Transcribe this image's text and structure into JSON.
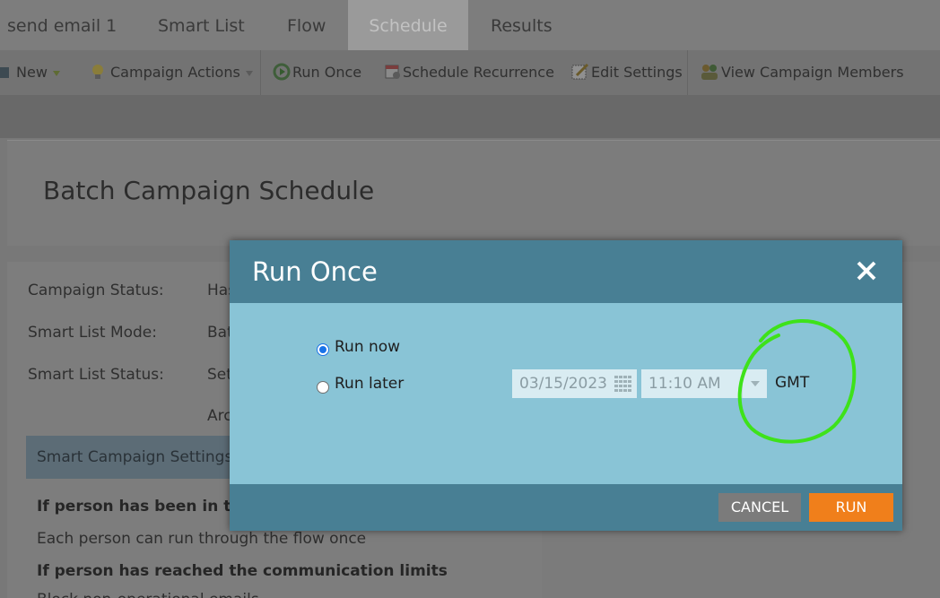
{
  "tabs": [
    {
      "label": "send email 1"
    },
    {
      "label": "Smart List"
    },
    {
      "label": "Flow"
    },
    {
      "label": "Schedule",
      "active": true
    },
    {
      "label": "Results"
    }
  ],
  "toolbar": {
    "new_label": "New",
    "campaign_actions_label": "Campaign Actions",
    "run_once_label": "Run Once",
    "schedule_recurrence_label": "Schedule Recurrence",
    "edit_settings_label": "Edit Settings",
    "view_members_label": "View Campaign Members"
  },
  "page": {
    "title": "Batch Campaign Schedule"
  },
  "info": {
    "campaign_status_label": "Campaign Status:",
    "campaign_status_value": "Has",
    "smart_list_mode_label": "Smart List Mode:",
    "smart_list_mode_value": "Bat",
    "smart_list_status_label": "Smart List Status:",
    "smart_list_status_value": "Set",
    "extra_value": "Arc"
  },
  "settings": {
    "title": "Smart Campaign Settings",
    "rule1": "If person has been in thi",
    "rule1_value": "Each person can run through the flow once",
    "rule2": "If person has reached the communication limits",
    "rule2_value": "Block non-operational emails"
  },
  "modal": {
    "title": "Run Once",
    "option_now": "Run now",
    "option_later": "Run later",
    "selected": "Run now",
    "date_value": "03/15/2023",
    "time_value": "11:10 AM",
    "timezone": "GMT",
    "cancel_label": "CANCEL",
    "run_label": "RUN"
  },
  "colors": {
    "modal_header": "#487f94",
    "modal_body": "#89c4d6",
    "run_button": "#f07f1b",
    "annotation": "#3ee21a"
  }
}
